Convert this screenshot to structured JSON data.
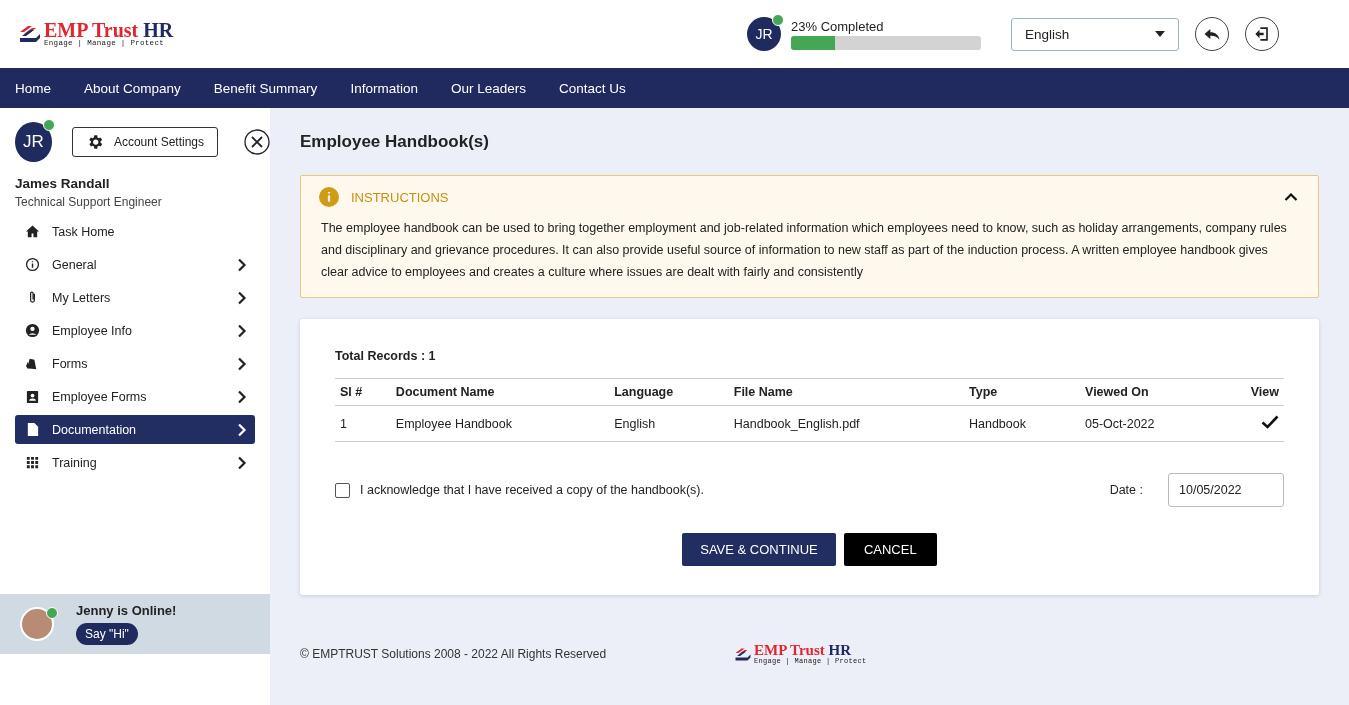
{
  "header": {
    "logo": {
      "brand": "EMP Trust",
      "brand_suffix": "HR",
      "tagline": "Engage | Manage | Protect"
    },
    "user_initials": "JR",
    "online": true,
    "progress_label": "23% Completed",
    "level": 0.23,
    "language": "English"
  },
  "nav": [
    {
      "label": "Home"
    },
    {
      "label": "About Company"
    },
    {
      "label": "Benefit Summary"
    },
    {
      "label": "Information"
    },
    {
      "label": "Our Leaders"
    },
    {
      "label": "Contact Us"
    }
  ],
  "sidebar": {
    "initials": "JR",
    "online": true,
    "account_button": "Account Settings",
    "name": "James Randall",
    "role": "Technical Support Engineer",
    "items": [
      {
        "label": "Task Home",
        "kind": "home",
        "has_submenu": false,
        "selected": false
      },
      {
        "label": "General",
        "kind": "info",
        "has_submenu": true,
        "selected": false
      },
      {
        "label": "My Letters",
        "kind": "clip",
        "has_submenu": true,
        "selected": false
      },
      {
        "label": "Employee Info",
        "kind": "person",
        "has_submenu": true,
        "selected": false
      },
      {
        "label": "Forms",
        "kind": "cards",
        "has_submenu": true,
        "selected": false
      },
      {
        "label": "Employee Forms",
        "kind": "badge",
        "has_submenu": true,
        "selected": false
      },
      {
        "label": "Documentation",
        "kind": "doc",
        "has_submenu": true,
        "selected": true
      },
      {
        "label": "Training",
        "kind": "grid",
        "has_submenu": true,
        "selected": false
      }
    ],
    "chat": {
      "title": "Jenny is Online!",
      "online": true,
      "button": "Say \"Hi\""
    }
  },
  "page_title": "Employee Handbook(s)",
  "instructions": {
    "title": "INSTRUCTIONS",
    "expanded": true,
    "text": "The employee handbook can be used to bring together employment and job-related information which employees need to know, such as holiday arrangements, company rules and disciplinary and grievance procedures. It can also provide useful source of information to new staff as part of the induction process. A written employee handbook gives clear advice to employees and creates a culture where issues are dealt with fairly and consistently"
  },
  "records": {
    "total": "Total Records : 1",
    "columns": [
      "Sl #",
      "Document Name",
      "Language",
      "File Name",
      "Type",
      "Viewed On",
      "View"
    ],
    "rows": [
      {
        "cells": [
          "1",
          "Employee Handbook",
          "English",
          "Handbook_English.pdf",
          "Handbook",
          "05-Oct-2022"
        ],
        "viewed": true
      }
    ]
  },
  "acknowledge": {
    "label": "I acknowledge that I have received a copy of the handbook(s).",
    "checked": false
  },
  "date": {
    "label": "Date :",
    "value": "10/05/2022"
  },
  "buttons": [
    "SAVE & CONTINUE",
    "CANCEL"
  ],
  "footer": {
    "copyright": "© EMPTRUST Solutions 2008 - 2022 All Rights Reserved",
    "logo": {
      "brand": "EMP Trust",
      "brand_suffix": "HR",
      "tagline": "Engage | Manage | Protect"
    }
  }
}
